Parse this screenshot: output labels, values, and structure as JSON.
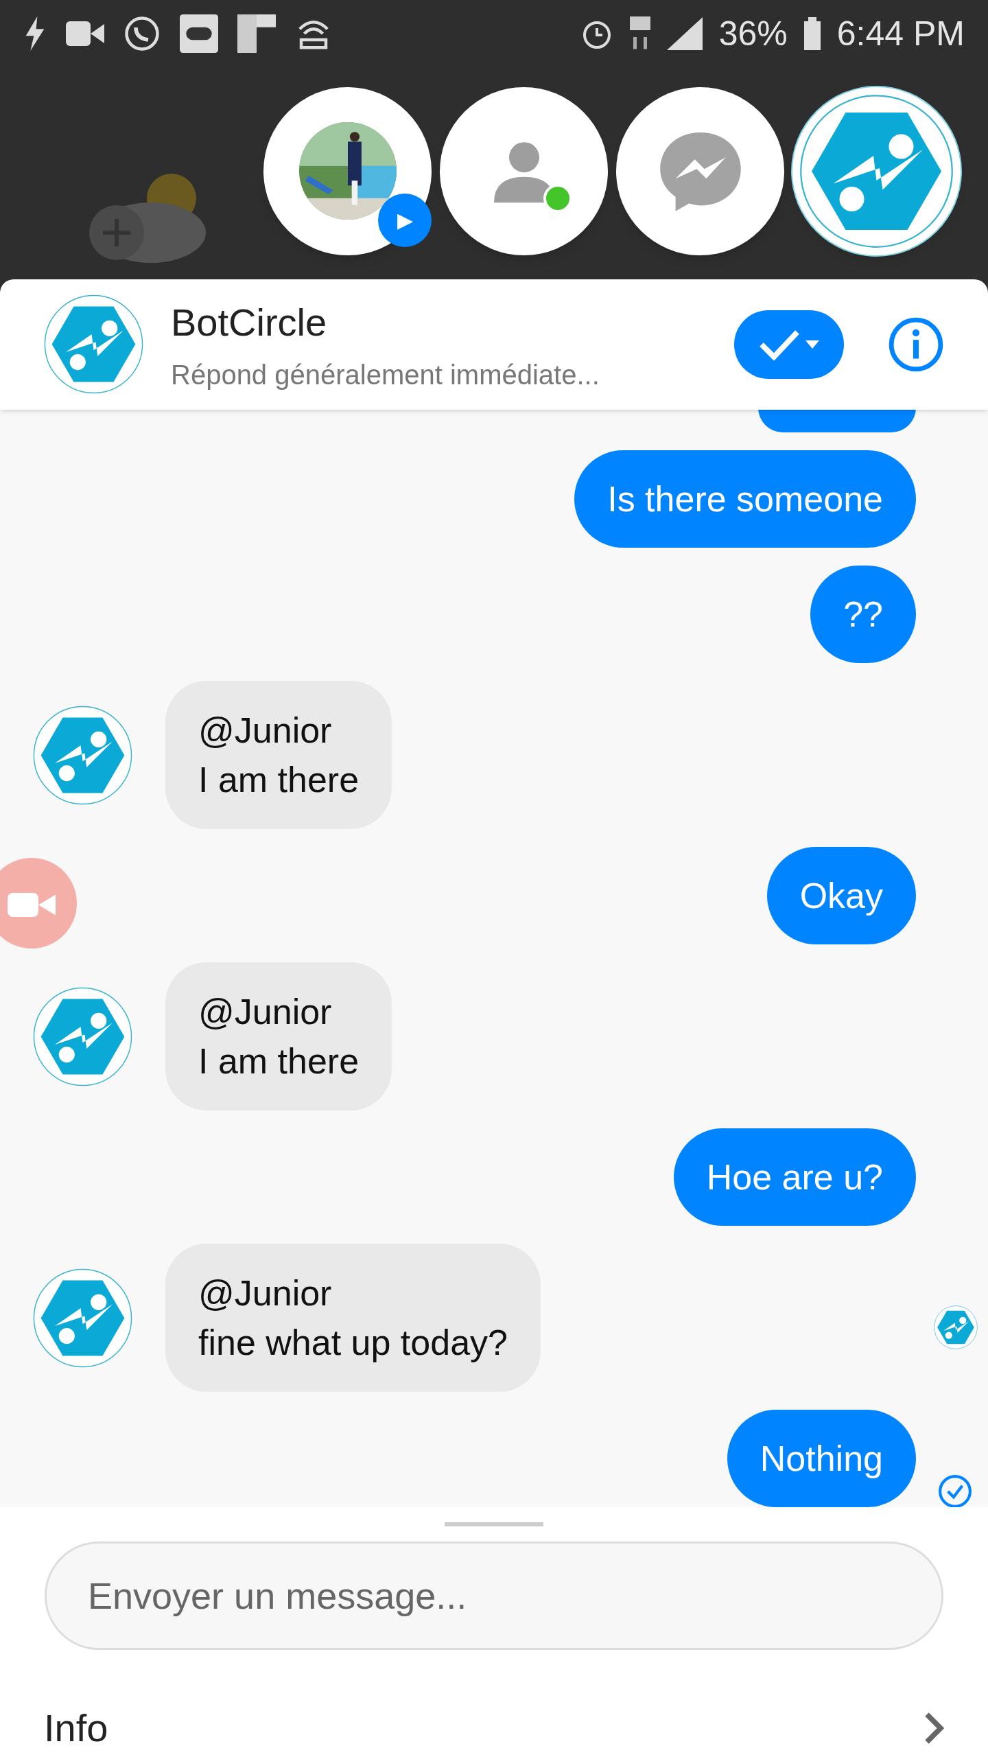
{
  "status_bar": {
    "battery": "36%",
    "time": "6:44 PM"
  },
  "chat_heads": [
    {
      "badge": "▶",
      "selected": false
    },
    {
      "kind": "contact",
      "online": true,
      "selected": false
    },
    {
      "kind": "messenger",
      "selected": false
    },
    {
      "kind": "bot",
      "selected": true
    }
  ],
  "header": {
    "name": "BotCircle",
    "subtitle": "Répond généralement immédiate..."
  },
  "messages": [
    {
      "kind": "partial"
    },
    {
      "kind": "sent",
      "lines": [
        "Is there someone"
      ]
    },
    {
      "kind": "sent",
      "lines": [
        "??"
      ]
    },
    {
      "kind": "received",
      "lines": [
        "@Junior",
        "I am there"
      ]
    },
    {
      "kind": "sent",
      "lines": [
        "Okay"
      ]
    },
    {
      "kind": "received",
      "lines": [
        "@Junior",
        "I am there"
      ]
    },
    {
      "kind": "sent",
      "lines": [
        "Hoe are u?"
      ]
    },
    {
      "kind": "received",
      "lines": [
        "@Junior",
        "fine what up today?"
      ],
      "seen": true
    },
    {
      "kind": "sent",
      "lines": [
        "Nothing"
      ],
      "delivered": true
    }
  ],
  "composer": {
    "placeholder": "Envoyer un message..."
  },
  "info_row": {
    "label": "Info"
  }
}
